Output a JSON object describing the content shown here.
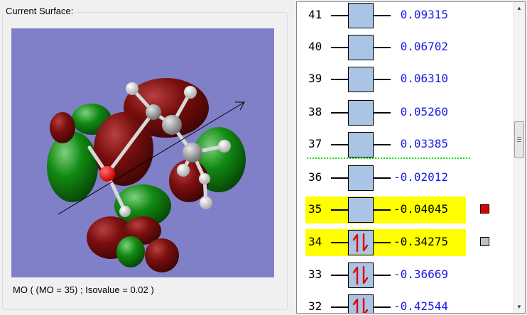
{
  "surface_panel": {
    "title": "Current Surface:",
    "caption": "MO ( (MO = 35) ; Isovalue = 0.02 )"
  },
  "colors": {
    "viewport_bg": "#8080c8",
    "positive_lobe": "#7a0f0f",
    "negative_lobe": "#128a12",
    "highlight": "#ffff00",
    "energy_text": "#1a1ae6",
    "homo_lumo_separator": "#00dd00"
  },
  "mo_list": {
    "rows": [
      {
        "number": "41",
        "energy": " 0.09315",
        "occupied": false,
        "selected": false,
        "swatch": ""
      },
      {
        "number": "40",
        "energy": " 0.06702",
        "occupied": false,
        "selected": false,
        "swatch": ""
      },
      {
        "number": "39",
        "energy": " 0.06310",
        "occupied": false,
        "selected": false,
        "swatch": ""
      },
      {
        "number": "38",
        "energy": " 0.05260",
        "occupied": false,
        "selected": false,
        "swatch": ""
      },
      {
        "number": "37",
        "energy": " 0.03385",
        "occupied": false,
        "selected": false,
        "swatch": ""
      },
      {
        "number": "36",
        "energy": "-0.02012",
        "occupied": false,
        "selected": false,
        "swatch": ""
      },
      {
        "number": "35",
        "energy": "-0.04045",
        "occupied": false,
        "selected": true,
        "swatch": "#dd0000"
      },
      {
        "number": "34",
        "energy": "-0.34275",
        "occupied": true,
        "selected": true,
        "swatch": "#c0c0c0"
      },
      {
        "number": "33",
        "energy": "-0.36669",
        "occupied": true,
        "selected": false,
        "swatch": ""
      },
      {
        "number": "32",
        "energy": "-0.42544",
        "occupied": true,
        "selected": false,
        "swatch": ""
      }
    ]
  },
  "scrollbar": {
    "up_icon": "scroll-up-arrow-icon",
    "down_icon": "scroll-down-arrow-icon"
  }
}
